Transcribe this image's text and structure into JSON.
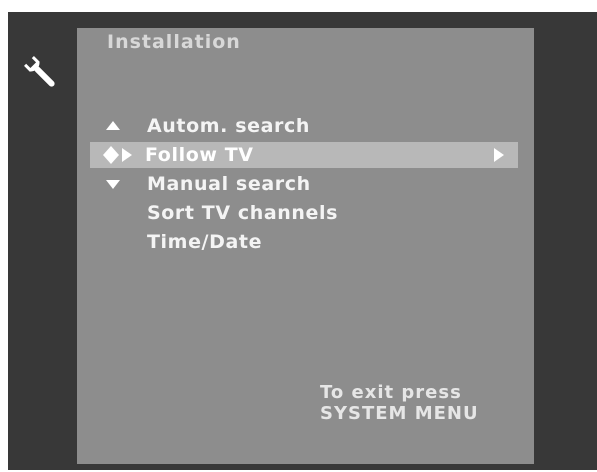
{
  "screen": {
    "title": "Installation",
    "icon": "wrench-icon"
  },
  "menu": {
    "items": [
      {
        "label": "Autom. search",
        "indicator": "up-arrow-icon"
      },
      {
        "label": "Follow TV",
        "indicator": "nav-cursor-icon",
        "selected": true,
        "has_submenu": true
      },
      {
        "label": "Manual search",
        "indicator": "down-arrow-icon"
      },
      {
        "label": "Sort TV channels"
      },
      {
        "label": "Time/Date"
      }
    ]
  },
  "footer": {
    "hint_line1": "To exit press",
    "hint_line2": "SYSTEM MENU"
  },
  "colors": {
    "frame": "#383838",
    "panel": "#8d8d8d",
    "highlight": "#b8b8b8",
    "text": "#f4f4f4"
  }
}
